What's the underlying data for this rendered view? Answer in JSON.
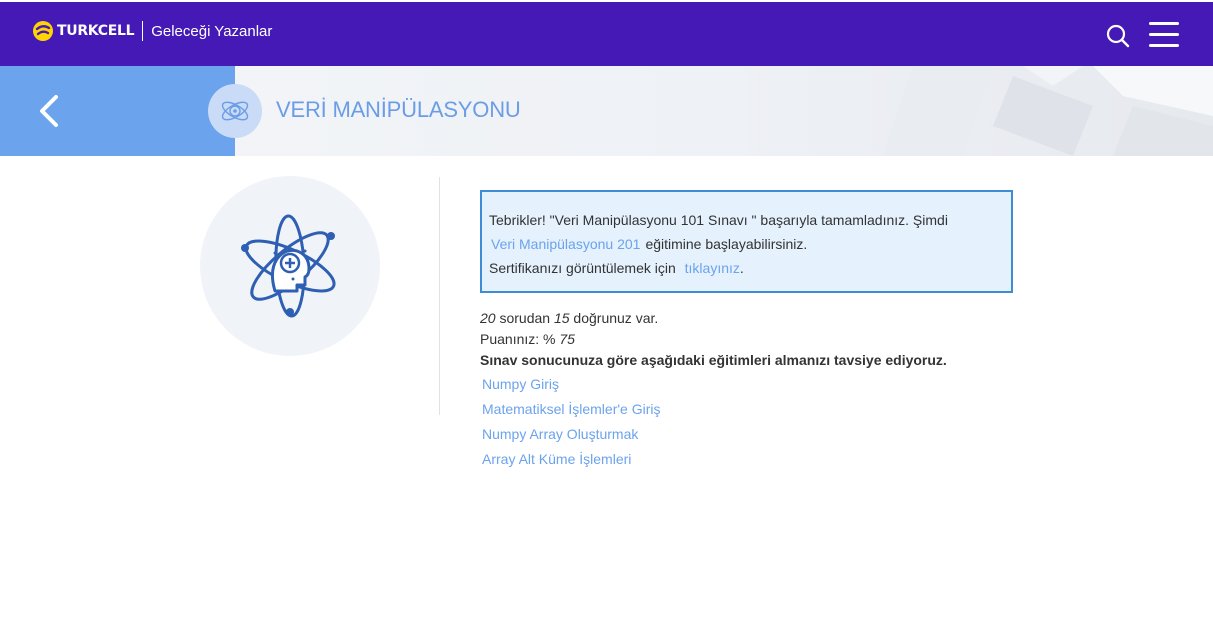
{
  "header": {
    "brand": "TURKCELL",
    "tagline": "Geleceği Yazanlar",
    "colors": {
      "bar": "#4519b5",
      "logo": "#ffd500"
    },
    "icons": {
      "search": "search-icon",
      "menu": "hamburger-menu-icon"
    }
  },
  "banner": {
    "title": "VERİ MANİPÜLASYONU",
    "back_icon": "chevron-left-icon",
    "course_icon": "atom-icon"
  },
  "result": {
    "line1_prefix": "Tebrikler! \"Veri Manipülasyonu 101 Sınavı \" başarıyla tamamladınız. Şimdi",
    "next_course_link": "Veri Manipülasyonu 201",
    "line2_suffix": "eğitimine başlayabilirsiniz.",
    "cert_prefix": "Sertifikanızı görüntülemek için",
    "cert_link": "tıklayınız",
    "cert_suffix": "."
  },
  "score": {
    "total": "20",
    "total_text": "sorudan",
    "correct": "15",
    "correct_text": "doğrunuz var.",
    "points_label": "Puanınız: %",
    "points": "75",
    "recommendation_text": "Sınav sonucunuza göre aşağıdaki eğitimleri almanızı tavsiye ediyoruz."
  },
  "recommendations": [
    "Numpy Giriş",
    "Matematiksel İşlemler'e Giriş",
    "Numpy Array Oluşturmak",
    "Array Alt Küme İşlemleri"
  ]
}
